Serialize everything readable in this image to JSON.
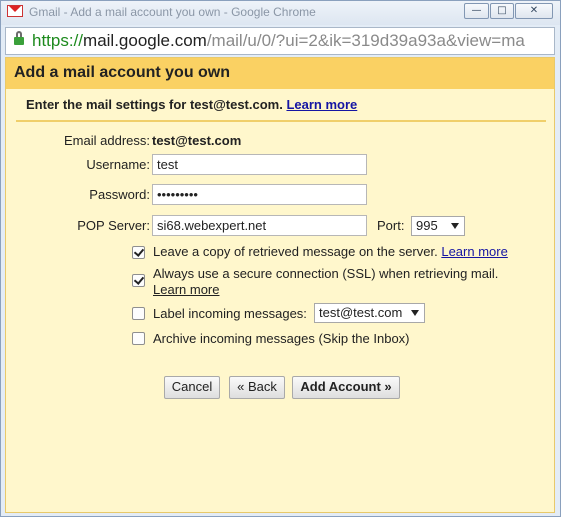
{
  "window": {
    "title": "Gmail - Add a mail account you own - Google Chrome",
    "minimize_symbol": "—",
    "maximize_symbol": "□",
    "close_symbol": "✕"
  },
  "address_bar": {
    "scheme": "https://",
    "host": "mail.google.com",
    "path": "/mail/u/0/?ui=2&ik=319d39a93a&view=ma"
  },
  "dialog": {
    "title": "Add a mail account you own",
    "subtitle": "Enter the mail settings for test@test.com.",
    "subtitle_link": "Learn more",
    "fields": {
      "email_label": "Email address:",
      "email_value": "test@test.com",
      "username_label": "Username:",
      "username_value": "test",
      "password_label": "Password:",
      "password_value": "•••••••••",
      "pop_server_label": "POP Server:",
      "pop_server_value": "si68.webexpert.net",
      "port_label": "Port:",
      "port_value": "995"
    },
    "options": {
      "leave_copy": {
        "label": "Leave a copy of retrieved message on the server.",
        "link": "Learn more",
        "checked": true
      },
      "secure_ssl": {
        "label": "Always use a secure connection (SSL) when retrieving mail.",
        "link": "Learn more",
        "checked": true
      },
      "label_incoming": {
        "label": "Label incoming messages:",
        "selected": "test@test.com",
        "checked": false
      },
      "archive": {
        "label": "Archive incoming messages (Skip the Inbox)",
        "checked": false
      }
    },
    "buttons": {
      "cancel": "Cancel",
      "back": "« Back",
      "add_account": "Add Account »"
    }
  },
  "colors": {
    "dialog_header": "#fad163",
    "dialog_body": "#fff7cc",
    "link": "#1515a3",
    "scheme_green": "#1d8a1d"
  }
}
